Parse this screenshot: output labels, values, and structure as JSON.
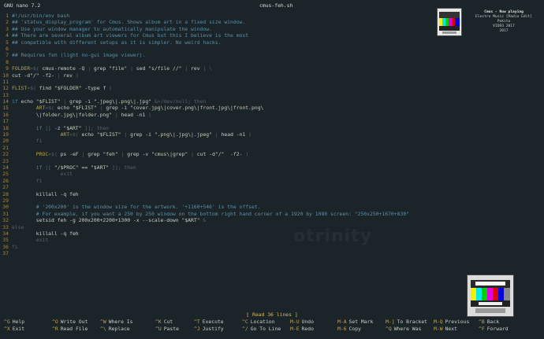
{
  "topbar": {
    "version": "GNU nano 7.2",
    "filename": "cmus-feh.sh"
  },
  "now_playing": {
    "title": "Cmus - Now playing",
    "lines": [
      "Electro Music [Radio Edit]",
      "Pokito",
      "VIDEO 2017",
      "2017"
    ]
  },
  "watermark": "otrinity",
  "status": "[ Read 36 lines ]",
  "lines": [
    {
      "n": "1",
      "parts": [
        {
          "c": "comment",
          "t": "#!/usr/bin/env bash"
        }
      ]
    },
    {
      "n": "2",
      "parts": [
        {
          "c": "comment",
          "t": "## 'status_display_program' for Cmus. Shows album art in a fixed size window."
        }
      ]
    },
    {
      "n": "3",
      "parts": [
        {
          "c": "comment",
          "t": "## Use your window manager to automatically manipulate the window."
        }
      ]
    },
    {
      "n": "4",
      "parts": [
        {
          "c": "comment",
          "t": "## There are several album art viewers for Cmus but this I believe is the most"
        }
      ]
    },
    {
      "n": "5",
      "parts": [
        {
          "c": "comment",
          "t": "## compatible with different setups as it is simpler. No weird hacks."
        }
      ]
    },
    {
      "n": "6",
      "parts": []
    },
    {
      "n": "7",
      "parts": [
        {
          "c": "comment",
          "t": "## Requires feh (light no-gui image viewer)."
        }
      ]
    },
    {
      "n": "8",
      "parts": []
    },
    {
      "n": "9",
      "parts": [
        {
          "c": "var",
          "t": "FOLDER"
        },
        {
          "c": "dim",
          "t": "=$( "
        },
        {
          "c": "plain",
          "t": "cmus-remote -Q "
        },
        {
          "c": "dim",
          "t": "| "
        },
        {
          "c": "plain",
          "t": "grep "
        },
        {
          "c": "str",
          "t": "\"file\" "
        },
        {
          "c": "dim",
          "t": "| "
        },
        {
          "c": "plain",
          "t": "sed "
        },
        {
          "c": "str",
          "t": "\"s/file //\" "
        },
        {
          "c": "dim",
          "t": "| "
        },
        {
          "c": "plain",
          "t": "rev "
        },
        {
          "c": "dim",
          "t": "| \\"
        }
      ]
    },
    {
      "n": "10",
      "parts": [
        {
          "c": "plain",
          "t": "cut -d\"/\" -f2- "
        },
        {
          "c": "dim",
          "t": "| "
        },
        {
          "c": "plain",
          "t": "rev "
        },
        {
          "c": "dim",
          "t": ")"
        }
      ]
    },
    {
      "n": "11",
      "parts": []
    },
    {
      "n": "12",
      "parts": [
        {
          "c": "var",
          "t": "FLIST"
        },
        {
          "c": "dim",
          "t": "=$( "
        },
        {
          "c": "plain",
          "t": "find "
        },
        {
          "c": "str",
          "t": "\"$FOLDER\" "
        },
        {
          "c": "plain",
          "t": "-type f "
        },
        {
          "c": "dim",
          "t": ")"
        }
      ]
    },
    {
      "n": "13",
      "parts": []
    },
    {
      "n": "14",
      "parts": [
        {
          "c": "kw",
          "t": "if "
        },
        {
          "c": "plain",
          "t": "echo "
        },
        {
          "c": "str",
          "t": "\"$FLIST\" "
        },
        {
          "c": "dim",
          "t": "| "
        },
        {
          "c": "plain",
          "t": "grep -i "
        },
        {
          "c": "str",
          "t": "\".jpeg\\|.png\\|.jpg\" "
        },
        {
          "c": "dim",
          "t": "&>/dev/null; then"
        }
      ]
    },
    {
      "n": "15",
      "parts": [
        {
          "c": "plain",
          "t": "        "
        },
        {
          "c": "var",
          "t": "ART"
        },
        {
          "c": "dim",
          "t": "=$( "
        },
        {
          "c": "plain",
          "t": "echo "
        },
        {
          "c": "str",
          "t": "\"$FLIST\" "
        },
        {
          "c": "dim",
          "t": "| "
        },
        {
          "c": "plain",
          "t": "grep -i "
        },
        {
          "c": "str",
          "t": "\"cover.jpg\\|cover.png\\|front.jpg\\|front.png\\"
        }
      ]
    },
    {
      "n": "16",
      "parts": [
        {
          "c": "str",
          "t": "        \\|folder.jpg\\|folder.png\" "
        },
        {
          "c": "dim",
          "t": "| "
        },
        {
          "c": "plain",
          "t": "head -n1 "
        },
        {
          "c": "dim",
          "t": ")"
        }
      ]
    },
    {
      "n": "17",
      "parts": []
    },
    {
      "n": "18",
      "parts": [
        {
          "c": "plain",
          "t": "        "
        },
        {
          "c": "kw",
          "t": "if "
        },
        {
          "c": "dim",
          "t": "[[ "
        },
        {
          "c": "plain",
          "t": "-z "
        },
        {
          "c": "str",
          "t": "\"$ART\" "
        },
        {
          "c": "dim",
          "t": "]]; then"
        }
      ]
    },
    {
      "n": "19",
      "parts": [
        {
          "c": "plain",
          "t": "                "
        },
        {
          "c": "var",
          "t": "ART"
        },
        {
          "c": "dim",
          "t": "=$( "
        },
        {
          "c": "plain",
          "t": "echo "
        },
        {
          "c": "str",
          "t": "\"$FLIST\" "
        },
        {
          "c": "dim",
          "t": "| "
        },
        {
          "c": "plain",
          "t": "grep -i "
        },
        {
          "c": "str",
          "t": "\".png\\|.jpg\\|.jpeg\" "
        },
        {
          "c": "dim",
          "t": "| "
        },
        {
          "c": "plain",
          "t": "head -n1 "
        },
        {
          "c": "dim",
          "t": ")"
        }
      ]
    },
    {
      "n": "20",
      "parts": [
        {
          "c": "dim",
          "t": "        fi"
        }
      ]
    },
    {
      "n": "21",
      "parts": []
    },
    {
      "n": "22",
      "parts": [
        {
          "c": "plain",
          "t": "        "
        },
        {
          "c": "var",
          "t": "PROC"
        },
        {
          "c": "dim",
          "t": "=$( "
        },
        {
          "c": "plain",
          "t": "ps -eF "
        },
        {
          "c": "dim",
          "t": "| "
        },
        {
          "c": "plain",
          "t": "grep "
        },
        {
          "c": "str",
          "t": "\"feh\" "
        },
        {
          "c": "dim",
          "t": "| "
        },
        {
          "c": "plain",
          "t": "grep -v "
        },
        {
          "c": "str",
          "t": "\"cmus\\|grep\" "
        },
        {
          "c": "dim",
          "t": "| "
        },
        {
          "c": "plain",
          "t": "cut -d\"/\"  -f2- "
        },
        {
          "c": "dim",
          "t": ")"
        }
      ]
    },
    {
      "n": "23",
      "parts": []
    },
    {
      "n": "24",
      "parts": [
        {
          "c": "plain",
          "t": "        "
        },
        {
          "c": "kw",
          "t": "if "
        },
        {
          "c": "dim",
          "t": "[[ "
        },
        {
          "c": "str",
          "t": "\"/$PROC\" "
        },
        {
          "c": "plain",
          "t": "== "
        },
        {
          "c": "str",
          "t": "\"$ART\" "
        },
        {
          "c": "dim",
          "t": "]]; then"
        }
      ]
    },
    {
      "n": "25",
      "parts": [
        {
          "c": "dim",
          "t": "                exit"
        }
      ]
    },
    {
      "n": "26",
      "parts": [
        {
          "c": "dim",
          "t": "        fi"
        }
      ]
    },
    {
      "n": "27",
      "parts": []
    },
    {
      "n": "28",
      "parts": [
        {
          "c": "plain",
          "t": "        killall -q feh"
        }
      ]
    },
    {
      "n": "29",
      "parts": []
    },
    {
      "n": "30",
      "parts": [
        {
          "c": "comment",
          "t": "        # '200x200' is the window size for the artwork. '+1160+546' is the offset."
        }
      ]
    },
    {
      "n": "31",
      "parts": [
        {
          "c": "comment",
          "t": "        # For example, if you want a 250 by 250 window on the bottom right hand corner of a 1920 by 1080 screen: \"250x250+1670+830\""
        }
      ]
    },
    {
      "n": "32",
      "parts": [
        {
          "c": "plain",
          "t": "        setsid feh -g 200x200+2200+1300 -x --scale-down "
        },
        {
          "c": "str",
          "t": "\"$ART\" "
        },
        {
          "c": "dim",
          "t": "&"
        }
      ]
    },
    {
      "n": "33",
      "parts": [
        {
          "c": "dim",
          "t": "else"
        }
      ]
    },
    {
      "n": "34",
      "parts": [
        {
          "c": "plain",
          "t": "        killall -q feh"
        }
      ]
    },
    {
      "n": "35",
      "parts": [
        {
          "c": "dim",
          "t": "        exit"
        }
      ]
    },
    {
      "n": "36",
      "parts": [
        {
          "c": "dim",
          "t": "fi"
        }
      ]
    },
    {
      "n": "37",
      "parts": []
    }
  ],
  "shortcuts": [
    [
      {
        "k": "^G",
        "l": "Help"
      },
      {
        "k": "^O",
        "l": "Write Out"
      },
      {
        "k": "^W",
        "l": "Where Is"
      },
      {
        "k": "^K",
        "l": "Cut"
      },
      {
        "k": "^T",
        "l": "Execute"
      },
      {
        "k": "^C",
        "l": "Location"
      },
      {
        "k": "M-U",
        "l": "Undo"
      },
      {
        "k": "M-A",
        "l": "Set Mark"
      },
      {
        "k": "M-]",
        "l": "To Bracket"
      },
      {
        "k": "M-Q",
        "l": "Previous"
      },
      {
        "k": "^B",
        "l": "Back"
      }
    ],
    [
      {
        "k": "^X",
        "l": "Exit"
      },
      {
        "k": "^R",
        "l": "Read File"
      },
      {
        "k": "^\\",
        "l": "Replace"
      },
      {
        "k": "^U",
        "l": "Paste"
      },
      {
        "k": "^J",
        "l": "Justify"
      },
      {
        "k": "^/",
        "l": "Go To Line"
      },
      {
        "k": "M-E",
        "l": "Redo"
      },
      {
        "k": "M-6",
        "l": "Copy"
      },
      {
        "k": "^Q",
        "l": "Where Was"
      },
      {
        "k": "M-W",
        "l": "Next"
      },
      {
        "k": "^F",
        "l": "Forward"
      }
    ]
  ]
}
